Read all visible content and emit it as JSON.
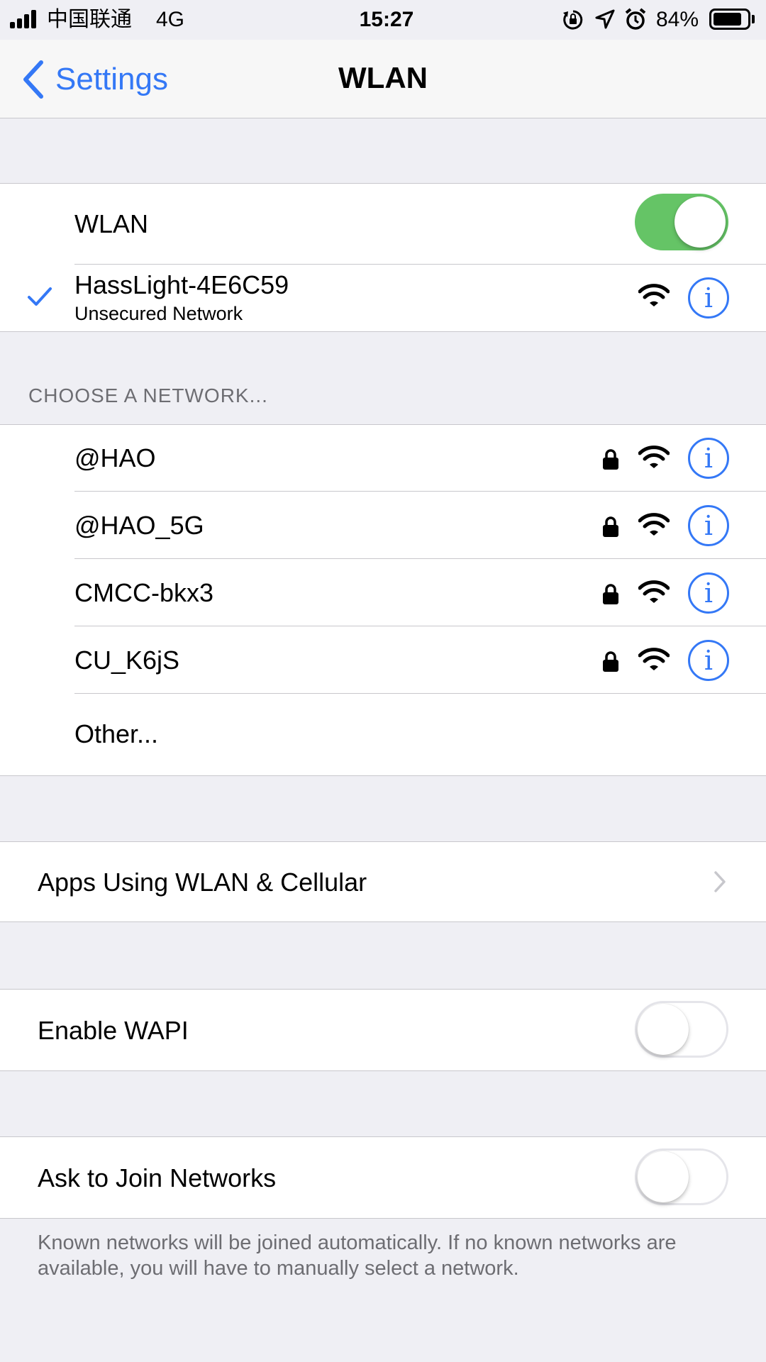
{
  "status_bar": {
    "carrier": "中国联通",
    "network": "4G",
    "time": "15:27",
    "battery": "84%",
    "battery_level": 0.84
  },
  "nav": {
    "back_label": "Settings",
    "title": "WLAN"
  },
  "wlan": {
    "label": "WLAN",
    "enabled": true,
    "connected": {
      "name": "HassLight-4E6C59",
      "subtitle": "Unsecured Network"
    }
  },
  "choose": {
    "header": "CHOOSE A NETWORK...",
    "networks": [
      {
        "name": "@HAO",
        "locked": true
      },
      {
        "name": "@HAO_5G",
        "locked": true
      },
      {
        "name": "CMCC-bkx3",
        "locked": true
      },
      {
        "name": "CU_K6jS",
        "locked": true
      }
    ],
    "other_label": "Other..."
  },
  "apps": {
    "label": "Apps Using WLAN & Cellular"
  },
  "wapi": {
    "label": "Enable WAPI",
    "enabled": false
  },
  "ask_join": {
    "label": "Ask to Join Networks",
    "enabled": false,
    "footer": "Known networks will be joined automatically. If no known networks are available, you will have to manually select a network."
  },
  "colors": {
    "accent": "#3478f6",
    "toggle_on": "#65c466",
    "background": "#efeff4"
  },
  "icons": {
    "info": "i",
    "check": "✓",
    "chevron": "›"
  }
}
